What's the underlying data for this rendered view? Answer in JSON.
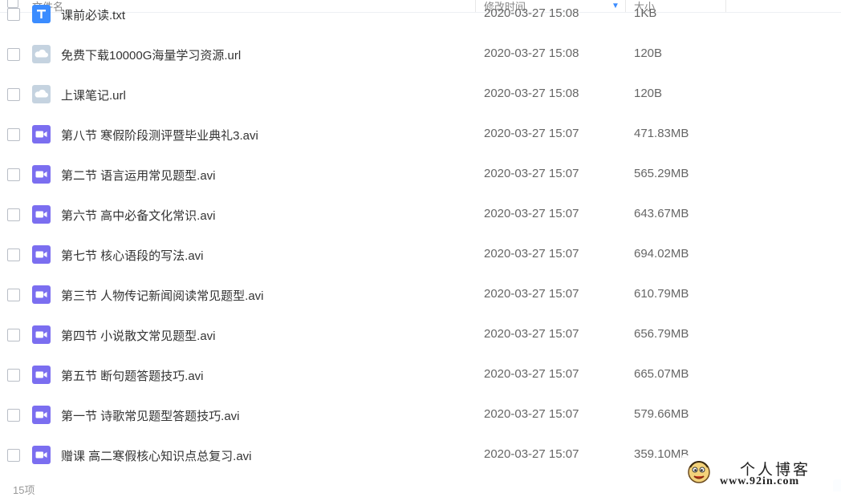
{
  "header": {
    "name_label": "文件名",
    "time_label": "修改时间",
    "size_label": "大小"
  },
  "files": [
    {
      "name": "课前必读.txt",
      "time": "2020-03-27 15:08",
      "size": "1KB",
      "icon": "text-file-icon",
      "color": "#3b8cff"
    },
    {
      "name": "免费下载10000G海量学习资源.url",
      "time": "2020-03-27 15:08",
      "size": "120B",
      "icon": "cloud-link-icon",
      "color": "#c5d3e0"
    },
    {
      "name": "上课笔记.url",
      "time": "2020-03-27 15:08",
      "size": "120B",
      "icon": "cloud-link-icon",
      "color": "#c5d3e0"
    },
    {
      "name": "第八节 寒假阶段测评暨毕业典礼3.avi",
      "time": "2020-03-27 15:07",
      "size": "471.83MB",
      "icon": "video-file-icon",
      "color": "#7b6ef0"
    },
    {
      "name": "第二节 语言运用常见题型.avi",
      "time": "2020-03-27 15:07",
      "size": "565.29MB",
      "icon": "video-file-icon",
      "color": "#7b6ef0"
    },
    {
      "name": "第六节  高中必备文化常识.avi",
      "time": "2020-03-27 15:07",
      "size": "643.67MB",
      "icon": "video-file-icon",
      "color": "#7b6ef0"
    },
    {
      "name": "第七节 核心语段的写法.avi",
      "time": "2020-03-27 15:07",
      "size": "694.02MB",
      "icon": "video-file-icon",
      "color": "#7b6ef0"
    },
    {
      "name": "第三节 人物传记新闻阅读常见题型.avi",
      "time": "2020-03-27 15:07",
      "size": "610.79MB",
      "icon": "video-file-icon",
      "color": "#7b6ef0"
    },
    {
      "name": "第四节 小说散文常见题型.avi",
      "time": "2020-03-27 15:07",
      "size": "656.79MB",
      "icon": "video-file-icon",
      "color": "#7b6ef0"
    },
    {
      "name": "第五节 断句题答题技巧.avi",
      "time": "2020-03-27 15:07",
      "size": "665.07MB",
      "icon": "video-file-icon",
      "color": "#7b6ef0"
    },
    {
      "name": "第一节 诗歌常见题型答题技巧.avi",
      "time": "2020-03-27 15:07",
      "size": "579.66MB",
      "icon": "video-file-icon",
      "color": "#7b6ef0"
    },
    {
      "name": "赠课 高二寒假核心知识点总复习.avi",
      "time": "2020-03-27 15:07",
      "size": "359.10MB",
      "icon": "video-file-icon",
      "color": "#7b6ef0"
    }
  ],
  "footer": {
    "count_text": "15项"
  },
  "watermark": {
    "title": "个人博客",
    "url": "www.92in.com"
  }
}
